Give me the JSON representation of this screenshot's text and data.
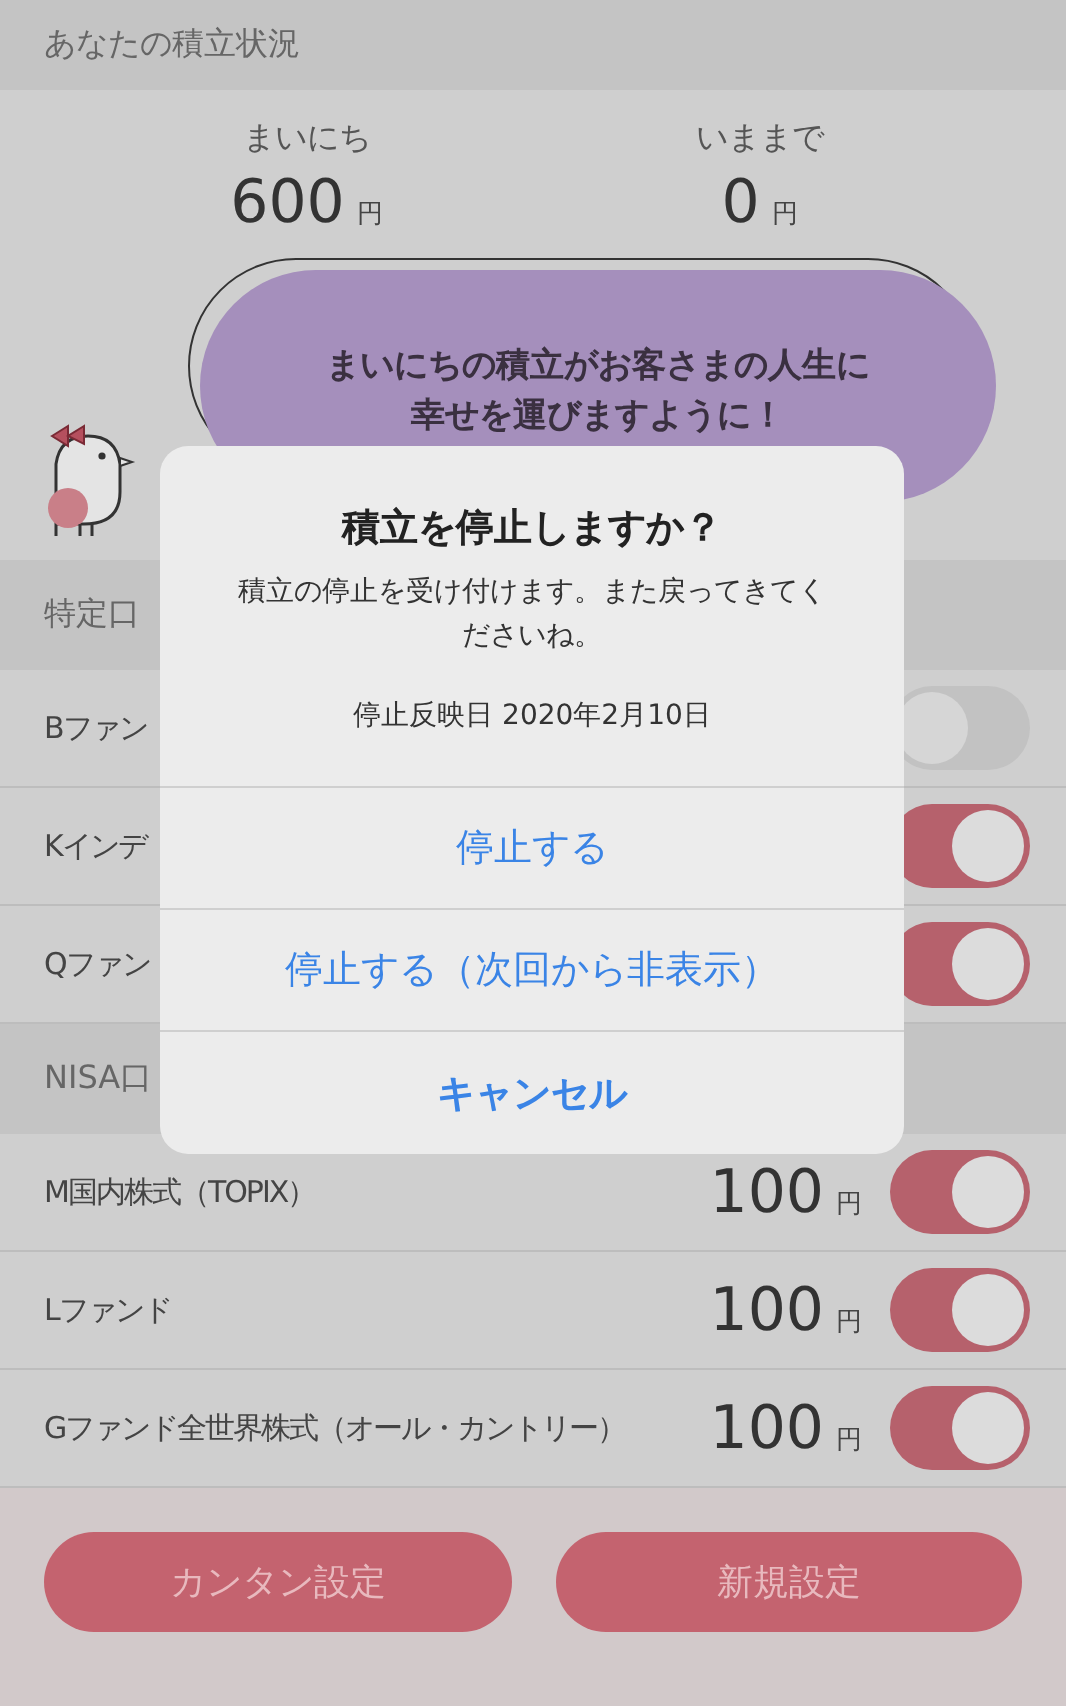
{
  "header": {
    "title": "あなたの積立状況"
  },
  "summary": [
    {
      "label": "まいにち",
      "amount": "600",
      "unit": "円"
    },
    {
      "label": "いままで",
      "amount": "0",
      "unit": "円"
    }
  ],
  "message": [
    "まいにちの積立がお客さまの人生に",
    "幸せを運びますように！"
  ],
  "sections": [
    {
      "title": "特定口",
      "funds": [
        {
          "name": "Bファン",
          "on": false
        },
        {
          "name": "Kインデ",
          "on": true
        },
        {
          "name": "Qファン",
          "on": true
        }
      ]
    },
    {
      "title": "NISA口",
      "funds": [
        {
          "name": "M国内株式（TOPIX）",
          "amount": "100",
          "unit": "円",
          "on": true
        },
        {
          "name": "Lファンド",
          "amount": "100",
          "unit": "円",
          "on": true
        },
        {
          "name": "Gファンド全世界株式（オール・カントリー）",
          "amount": "100",
          "unit": "円",
          "on": true
        }
      ]
    }
  ],
  "dialog": {
    "title": "積立を停止しますか？",
    "message": "積立の停止を受け付けます。また戻ってきてくださいね。",
    "date": "停止反映日 2020年2月10日",
    "actions": [
      {
        "label": "停止する",
        "kind": "normal"
      },
      {
        "label": "停止する（次回から非表示）",
        "kind": "normal"
      },
      {
        "label": "キャンセル",
        "kind": "cancel"
      }
    ]
  },
  "buttons": [
    {
      "label": "カンタン設定"
    },
    {
      "label": "新規設定"
    }
  ]
}
